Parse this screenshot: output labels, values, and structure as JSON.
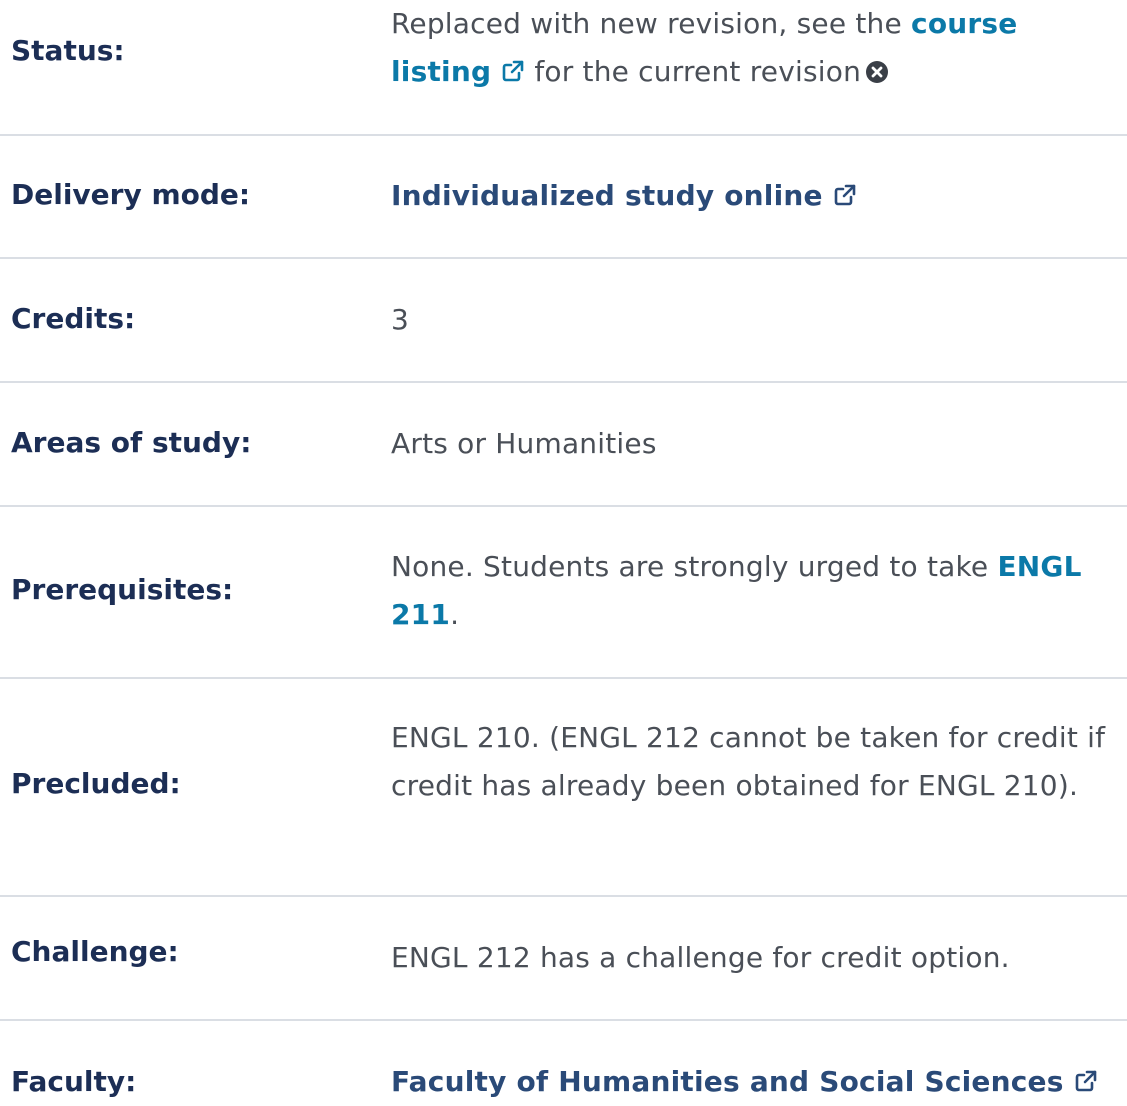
{
  "status": {
    "label": "Status:",
    "text_before": "Replaced with new revision, see the ",
    "link_text": "course listing",
    "text_after": " for the current revision"
  },
  "delivery_mode": {
    "label": "Delivery mode:",
    "link_text": "Individualized study online"
  },
  "credits": {
    "label": "Credits:",
    "value": "3"
  },
  "areas_of_study": {
    "label": "Areas of study:",
    "value": "Arts or Humanities"
  },
  "prerequisites": {
    "label": "Prerequisites:",
    "text_before": "None. Students are strongly urged to take ",
    "link_text": "ENGL 211",
    "text_after": "."
  },
  "precluded": {
    "label": "Precluded:",
    "value": "ENGL 210. (ENGL 212 cannot be taken for credit if credit has already been obtained for ENGL 210)."
  },
  "challenge": {
    "label": "Challenge:",
    "value": "ENGL 212 has a challenge for credit option."
  },
  "faculty": {
    "label": "Faculty:",
    "link_text": "Faculty of Humanities and Social Sciences"
  },
  "colors": {
    "label": "#1c2e55",
    "link": "#0b79a8",
    "link_dark": "#2a4a78",
    "text": "#4a4f57",
    "divider": "#dadee4"
  },
  "icons": {
    "external_link": "external-link-icon",
    "close": "close-circle-icon"
  }
}
